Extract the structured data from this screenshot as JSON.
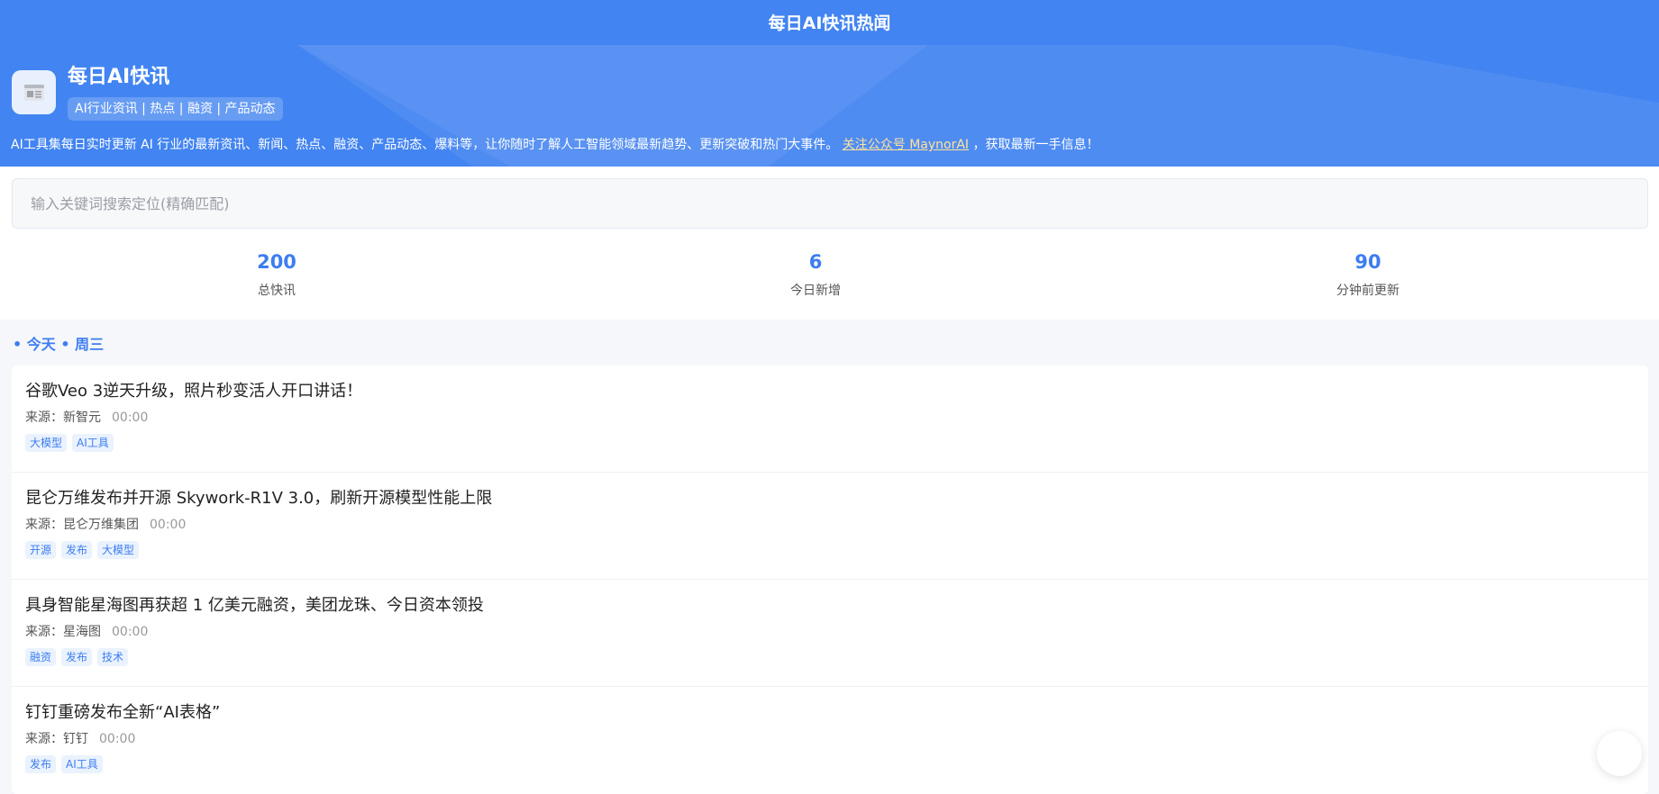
{
  "header": {
    "top_title": "每日AI快讯热闻",
    "brand_title": "每日AI快讯",
    "brand_tags": "AI行业资讯 | 热点 | 融资 | 产品动态",
    "description_prefix": "AI工具集每日实时更新 AI 行业的最新资讯、新闻、热点、融资、产品动态、爆料等，让你随时了解人工智能领域最新趋势、更新突破和热门大事件。 ",
    "description_link": "关注公众号 MaynorAI",
    "description_suffix": " ，获取最新一手信息！",
    "logo_icon": "newspaper-icon"
  },
  "search": {
    "placeholder": "输入关键词搜索定位(精确匹配)"
  },
  "stats": [
    {
      "value": "200",
      "label": "总快讯"
    },
    {
      "value": "6",
      "label": "今日新增"
    },
    {
      "value": "90",
      "label": "分钟前更新"
    }
  ],
  "feed": {
    "day_header": "• 今天 • 周三",
    "items": [
      {
        "title": "谷歌Veo 3逆天升级，照片秒变活人开口讲话！",
        "source": "来源：新智元",
        "time": "00:00",
        "tags": [
          "大模型",
          "AI工具"
        ]
      },
      {
        "title": "昆仑万维发布并开源 Skywork-R1V 3.0，刷新开源模型性能上限",
        "source": "来源：昆仑万维集团",
        "time": "00:00",
        "tags": [
          "开源",
          "发布",
          "大模型"
        ]
      },
      {
        "title": "具身智能星海图再获超 1 亿美元融资，美团龙珠、今日资本领投",
        "source": "来源：星海图",
        "time": "00:00",
        "tags": [
          "融资",
          "发布",
          "技术"
        ]
      },
      {
        "title": "钉钉重磅发布全新“AI表格”",
        "source": "来源：钉钉",
        "time": "00:00",
        "tags": [
          "发布",
          "AI工具"
        ]
      }
    ]
  },
  "colors": {
    "primary": "#4284f1",
    "accent_text": "#3d7df0",
    "tag_bg": "#eaf2fe",
    "link": "#ffe29a"
  }
}
